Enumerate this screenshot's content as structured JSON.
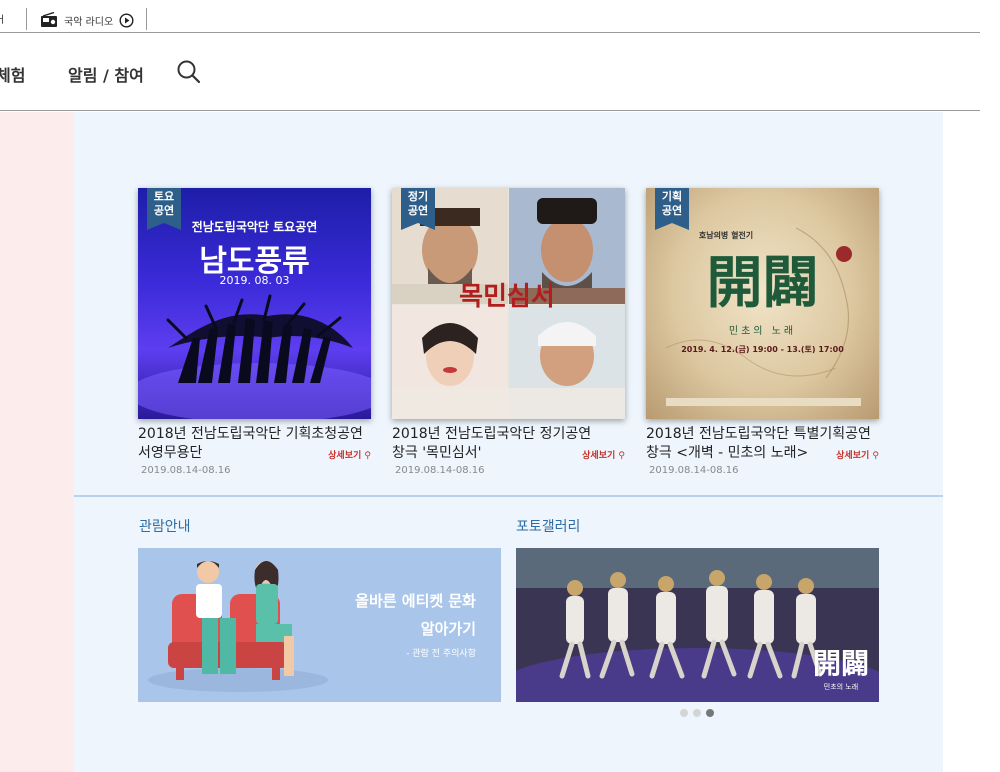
{
  "topbar": {
    "left_fragment": "ㅓ",
    "radio_label": "국악 라디오"
  },
  "gnb": {
    "menu_fragment": "체험",
    "menu_notice": "알림 / 참여"
  },
  "performances": [
    {
      "badge_line1": "토요",
      "badge_line2": "공연",
      "poster_line1": "전남도립국악단 토요공연",
      "poster_line2": "남도풍류",
      "poster_line3": "2019. 08. 03",
      "title_line1": "2018년 전남도립국악단 기획초청공연",
      "title_line2": "서영무용단",
      "more_label": "상세보기",
      "date": "2019.08.14-08.16"
    },
    {
      "badge_line1": "정기",
      "badge_line2": "공연",
      "poster_line1": "목민심서",
      "title_line1": "2018년 전남도립국악단 정기공연",
      "title_line2": "창극 '목민심서'",
      "more_label": "상세보기",
      "date": "2019.08.14-08.16"
    },
    {
      "badge_line1": "기획",
      "badge_line2": "공연",
      "poster_line1": "호남의병 혈전기",
      "poster_line2": "開闢",
      "poster_line3": "민초의 노래",
      "poster_line4": "2019. 4. 12.(금) 19:00 - 13.(토) 17:00",
      "title_line1": "2018년 전남도립국악단 특별기획공연",
      "title_line2": "창극 <개벽 - 민초의 노래>",
      "more_label": "상세보기",
      "date": "2019.08.14-08.16"
    }
  ],
  "guide": {
    "title": "관람안내",
    "banner_line1": "올바른 에티켓 문화",
    "banner_line2": "알아가기",
    "banner_line3": "- 관람 전 주의사항"
  },
  "gallery": {
    "title": "포토갤러리",
    "logo_text": "開闢",
    "logo_sub": "민초의 노래"
  },
  "carousel": {
    "count": 3,
    "active_index": 2
  }
}
